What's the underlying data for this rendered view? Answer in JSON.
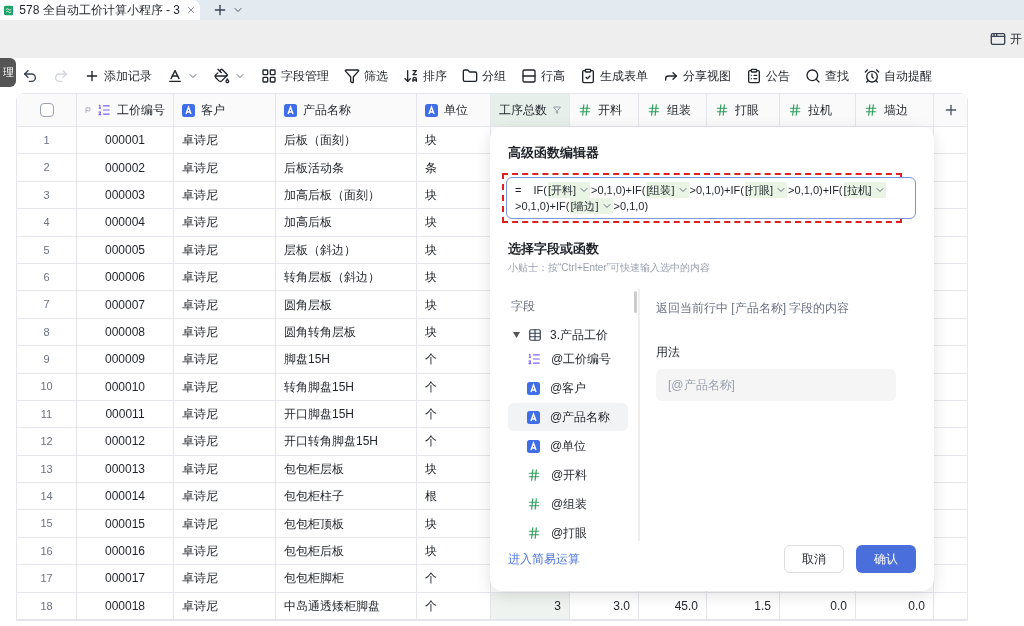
{
  "browser_tab": {
    "title": "578 全自动工价计算小程序 - 3"
  },
  "top_bar": {
    "right_label": "开"
  },
  "side_handle": {
    "label": "理"
  },
  "toolbar": [
    {
      "label": "添加记录"
    },
    {
      "label": "字段管理"
    },
    {
      "label": "筛选"
    },
    {
      "label": "排序"
    },
    {
      "label": "分组"
    },
    {
      "label": "行高"
    },
    {
      "label": "生成表单"
    },
    {
      "label": "分享视图"
    },
    {
      "label": "公告"
    },
    {
      "label": "查找"
    },
    {
      "label": "自动提醒"
    }
  ],
  "table": {
    "select_all": {
      "checked": false
    },
    "columns": [
      {
        "label": "工价编号",
        "kind": "autonum",
        "selected": false
      },
      {
        "label": "客户",
        "kind": "text",
        "selected": false
      },
      {
        "label": "产品名称",
        "kind": "text",
        "selected": false
      },
      {
        "label": "单位",
        "kind": "text",
        "selected": false
      },
      {
        "label": "工序总数",
        "kind": "formula",
        "selected": true
      },
      {
        "label": "开料",
        "kind": "number",
        "selected": false
      },
      {
        "label": "组装",
        "kind": "number",
        "selected": false
      },
      {
        "label": "打眼",
        "kind": "number",
        "selected": false
      },
      {
        "label": "拉机",
        "kind": "number",
        "selected": false
      },
      {
        "label": "墙边",
        "kind": "number",
        "selected": false
      }
    ],
    "rows": [
      {
        "no": "1",
        "cells": [
          "000001",
          "卓诗尼",
          "后板（面刻）",
          "块"
        ]
      },
      {
        "no": "2",
        "cells": [
          "000002",
          "卓诗尼",
          "后板活动条",
          "条"
        ]
      },
      {
        "no": "3",
        "cells": [
          "000003",
          "卓诗尼",
          "加高后板（面刻）",
          "块"
        ]
      },
      {
        "no": "4",
        "cells": [
          "000004",
          "卓诗尼",
          "加高后板",
          "块"
        ]
      },
      {
        "no": "5",
        "cells": [
          "000005",
          "卓诗尼",
          "层板（斜边）",
          "块"
        ]
      },
      {
        "no": "6",
        "cells": [
          "000006",
          "卓诗尼",
          "转角层板（斜边）",
          "块"
        ]
      },
      {
        "no": "7",
        "cells": [
          "000007",
          "卓诗尼",
          "圆角层板",
          "块"
        ]
      },
      {
        "no": "8",
        "cells": [
          "000008",
          "卓诗尼",
          "圆角转角层板",
          "块"
        ]
      },
      {
        "no": "9",
        "cells": [
          "000009",
          "卓诗尼",
          "脚盘15H",
          "个"
        ]
      },
      {
        "no": "10",
        "cells": [
          "000010",
          "卓诗尼",
          "转角脚盘15H",
          "个"
        ]
      },
      {
        "no": "11",
        "cells": [
          "000011",
          "卓诗尼",
          "开口脚盘15H",
          "个"
        ]
      },
      {
        "no": "12",
        "cells": [
          "000012",
          "卓诗尼",
          "开口转角脚盘15H",
          "个"
        ]
      },
      {
        "no": "13",
        "cells": [
          "000013",
          "卓诗尼",
          "包包柜层板",
          "块"
        ]
      },
      {
        "no": "14",
        "cells": [
          "000014",
          "卓诗尼",
          "包包柜柱子",
          "根"
        ]
      },
      {
        "no": "15",
        "cells": [
          "000015",
          "卓诗尼",
          "包包柜顶板",
          "块"
        ]
      },
      {
        "no": "16",
        "cells": [
          "000016",
          "卓诗尼",
          "包包柜后板",
          "块"
        ]
      },
      {
        "no": "17",
        "cells": [
          "000017",
          "卓诗尼",
          "包包柜脚柜",
          "个"
        ]
      },
      {
        "no": "18",
        "cells": [
          "000018",
          "卓诗尼",
          "中岛通透矮柜脚盘",
          "个",
          "3",
          "3.0",
          "45.0",
          "1.5",
          "0.0",
          "0.0"
        ]
      }
    ]
  },
  "dialog": {
    "title": "高级函数编辑器",
    "formula": {
      "prefix": "=",
      "tokens": [
        {
          "kind": "text",
          "text": "IF("
        },
        {
          "kind": "field",
          "text": "[开料]"
        },
        {
          "kind": "text",
          "text": ">0,1,0)+IF("
        },
        {
          "kind": "field",
          "text": "[组装]"
        },
        {
          "kind": "text",
          "text": ">0,1,0)+IF("
        },
        {
          "kind": "field",
          "text": "[打眼]"
        },
        {
          "kind": "text",
          "text": ">0,1,0)+IF("
        },
        {
          "kind": "field",
          "text": "[拉机]"
        },
        {
          "kind": "text",
          "text": ">0,1,0)+IF("
        },
        {
          "kind": "field",
          "text": "[墙边]"
        },
        {
          "kind": "text",
          "text": ">0,1,0)"
        }
      ]
    },
    "section_title": "选择字段或函数",
    "tip": "小贴士：按“Ctrl+Enter”可快速输入选中的内容",
    "field_list": {
      "heading": "字段",
      "table": {
        "label": "3.产品工价",
        "expanded": true,
        "children": [
          {
            "label": "@工价编号",
            "kind": "autonum",
            "selected": false
          },
          {
            "label": "@客户",
            "kind": "text",
            "selected": false
          },
          {
            "label": "@产品名称",
            "kind": "text",
            "selected": true
          },
          {
            "label": "@单位",
            "kind": "text",
            "selected": false
          },
          {
            "label": "@开料",
            "kind": "number",
            "selected": false
          },
          {
            "label": "@组装",
            "kind": "number",
            "selected": false
          },
          {
            "label": "@打眼",
            "kind": "number",
            "selected": false
          }
        ]
      }
    },
    "description": "返回当前行中 [产品名称] 字段的内容",
    "usage_heading": "用法",
    "usage_example": "[@产品名称]",
    "link": "进入简易运算",
    "cancel": "取消",
    "confirm": "确认"
  }
}
